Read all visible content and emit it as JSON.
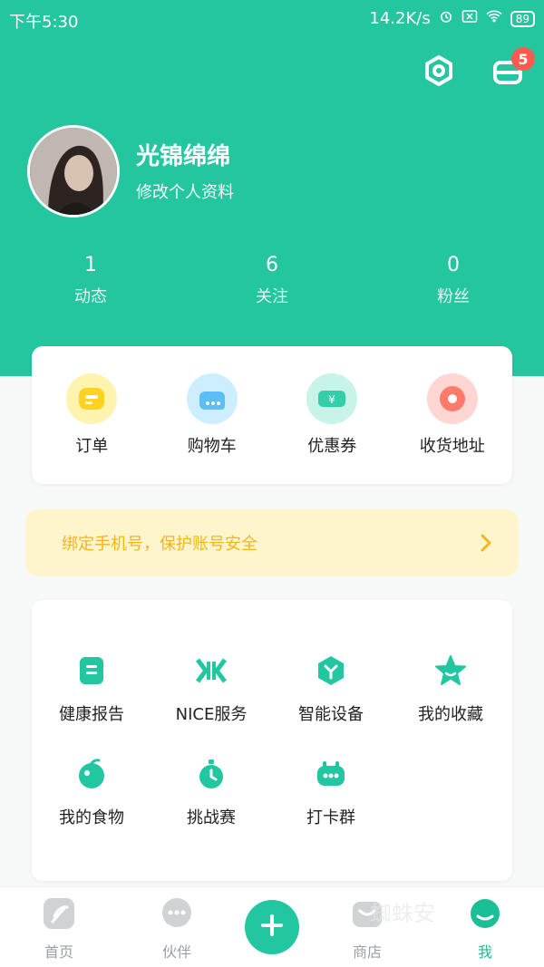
{
  "status_bar": {
    "time": "下午5:30",
    "network_speed": "14.2K/s",
    "battery": "89"
  },
  "header": {
    "notifications_count": "5"
  },
  "profile": {
    "name": "光锦绵绵",
    "edit_label": "修改个人资料"
  },
  "stats": [
    {
      "value": "1",
      "label": "动态"
    },
    {
      "value": "6",
      "label": "关注"
    },
    {
      "value": "0",
      "label": "粉丝"
    }
  ],
  "quick_actions": [
    {
      "label": "订单",
      "icon": "order-icon",
      "color": "#ffd83a"
    },
    {
      "label": "购物车",
      "icon": "cart-icon",
      "color": "#79c9ff"
    },
    {
      "label": "优惠券",
      "icon": "coupon-icon",
      "color": "#43d3b0"
    },
    {
      "label": "收货地址",
      "icon": "location-icon",
      "color": "#ff8a7a"
    }
  ],
  "phone_banner": {
    "text": "绑定手机号，保护账号安全"
  },
  "services": [
    {
      "label": "健康报告",
      "icon": "report-icon"
    },
    {
      "label": "NICE服务",
      "icon": "nice-service-icon"
    },
    {
      "label": "智能设备",
      "icon": "smart-device-icon"
    },
    {
      "label": "我的收藏",
      "icon": "star-icon"
    },
    {
      "label": "我的食物",
      "icon": "food-icon"
    },
    {
      "label": "挑战赛",
      "icon": "stopwatch-icon"
    },
    {
      "label": "打卡群",
      "icon": "checkin-group-icon"
    }
  ],
  "bottom_nav": [
    {
      "label": "首页",
      "icon": "home-icon"
    },
    {
      "label": "伙伴",
      "icon": "chat-icon"
    },
    {
      "label": "商店",
      "icon": "store-icon"
    },
    {
      "label": "我",
      "icon": "me-icon"
    }
  ],
  "watermark": "蜘蛛安",
  "colors": {
    "primary": "#24c6a0",
    "badge": "#ff5a4f",
    "banner_text": "#f3b51a"
  }
}
